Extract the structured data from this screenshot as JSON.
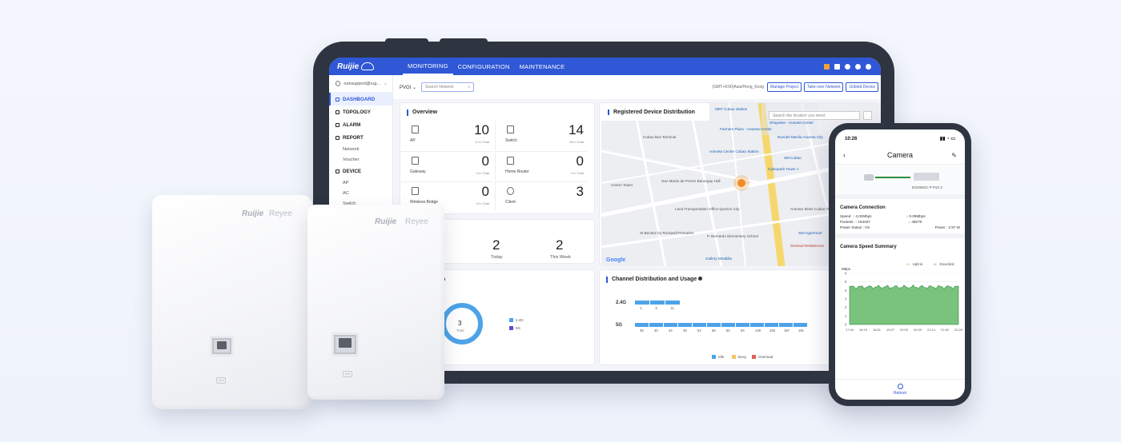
{
  "header": {
    "brand": "Ruijie",
    "tabs": [
      "MONITORING",
      "CONFIGURATION",
      "MAINTENANCE"
    ]
  },
  "sidebar": {
    "user": "ruiesupport@rug...",
    "items": [
      {
        "label": "DASHBOARD"
      },
      {
        "label": "TOPOLOGY"
      },
      {
        "label": "ALARM"
      },
      {
        "label": "REPORT"
      },
      {
        "label": "Network"
      },
      {
        "label": "Voucher"
      },
      {
        "label": "DEVICE"
      },
      {
        "label": "AP"
      },
      {
        "label": "AC"
      },
      {
        "label": "Switch"
      }
    ]
  },
  "toolbar": {
    "project": "PVGI",
    "search_placeholder": "Search Network",
    "timezone": "(GMT+8:00)Asia/Hong_Kong",
    "buttons": [
      "Manage Project",
      "Take over Network",
      "Unbind Device"
    ]
  },
  "overview": {
    "title": "Overview",
    "cells": [
      {
        "label": "AP",
        "value": "10",
        "sub": "11 in Total"
      },
      {
        "label": "Switch",
        "value": "14",
        "sub": "16 in Total"
      },
      {
        "label": "Gateway",
        "value": "0",
        "sub": "0 in Total"
      },
      {
        "label": "Home Router",
        "value": "0",
        "sub": "0 in Total"
      },
      {
        "label": "Wireless Bridge",
        "value": "0",
        "sub": "0 in Total"
      },
      {
        "label": "Client",
        "value": "3",
        "sub": ""
      }
    ]
  },
  "stats": {
    "today_value": "2",
    "today_label": "Today",
    "week_value": "2",
    "week_label": "This Week"
  },
  "clients": {
    "title_fragment": "ents",
    "total": "3",
    "total_label": "Total",
    "legend": [
      "2.4G",
      "5G"
    ]
  },
  "map": {
    "title": "Registered Device Distribution",
    "search_placeholder": "Search the location you need.",
    "labels": [
      "MRT Cubao Station",
      "Farmers Plaza - Araneta Center",
      "Shopwise - Araneta Center",
      "Novotel Manila Araneta City",
      "Ali Mall",
      "Araneta Center Cubao Station",
      "SM Cubao",
      "Cybarpark Tower 1",
      "Spark Place",
      "Cubao Bus Terminal",
      "San Martin de Porres Barangay Hall",
      "Centro Tower",
      "Land Transportation Office Quezon City",
      "St Benitez by Rockwell Primaries",
      "P. Bernardo Elementary School",
      "Araneta Skies Cubao Tower 2",
      "SM Hypermart",
      "Seminal Residences",
      "Gallery Mirabilla"
    ],
    "google": "Google",
    "footer": "Keyboard shortcuts · Map"
  },
  "channels": {
    "title": "Channel Distribution and Usage",
    "row_24": "2.4G",
    "row_5": "5G",
    "ch_24": [
      "1",
      "6",
      "11"
    ],
    "ch_5": [
      "36",
      "40",
      "44",
      "48",
      "52",
      "56",
      "60",
      "64",
      "149",
      "153",
      "157",
      "161"
    ],
    "legend": [
      "Idle",
      "Busy",
      "Overload"
    ]
  },
  "access_points": {
    "brand_a": "Ruijie",
    "brand_b": "Reyee",
    "led": "LED"
  },
  "phone": {
    "time": "10:26",
    "title": "Camera",
    "device": "ES206GC-P Port 2",
    "connection_title": "Camera Connection",
    "speed_label": "Speed:",
    "speed_up": "4.02Mbps",
    "speed_down": "0.08Mbps",
    "packets_label": "Packets:",
    "packets_up": "154467",
    "packets_down": "45579",
    "power_status": "Power Status : On",
    "power": "Power : 2.97 W",
    "summary_title": "Camera Speed Summary",
    "legend": [
      "Uplink",
      "Downlink"
    ],
    "unit": "Mbps",
    "y_ticks": [
      "6",
      "5",
      "4",
      "3",
      "2",
      "1",
      "0"
    ],
    "x_ticks": [
      "17:49",
      "18:15",
      "18:51",
      "19:27",
      "20:03",
      "20:39",
      "21:14",
      "21:50",
      "22:26"
    ],
    "reboot": "Reboot"
  }
}
